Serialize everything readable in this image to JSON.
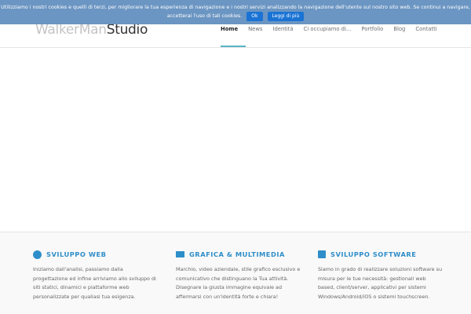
{
  "cookie_bar": {
    "text": "Utilizziamo i nostri cookies e quelli di terzi, per migliorare la tua esperienza di navigazione e i nostri servizi analizzando la navigazione dell'utente sul nostro sito web. Se continui a navigare, accetterai l'uso di tali cookies.",
    "ok_label": "Ok",
    "more_label": "Leggi di più"
  },
  "logo": {
    "part1": "WalkerMan",
    "part2": "Studio"
  },
  "nav": [
    "Home",
    "News",
    "Identità",
    "Ci occupiamo di...",
    "Portfolio",
    "Blog",
    "Contatti"
  ],
  "features": [
    {
      "icon": "globe-icon",
      "title": "SVILUPPO WEB",
      "text": "Iniziamo dall'analisi, passiamo dalla progettazione ed infine arriviamo allo sviluppo di siti statici, dinamici e piattaforme web personalizzate per qualiasi tua esigenza."
    },
    {
      "icon": "film-icon",
      "title": "GRAFICA & MULTIMEDIA",
      "text": "Marchio, video aziendale, stile grafico esclusivo e comunicativo che distinguano la Tua attività. Disegnare la giusta immagine equivale ad affermarsi con un'identità forte e chiara!"
    },
    {
      "icon": "floppy-disk-icon",
      "title": "SVILUPPO SOFTWARE",
      "text": "Siamo in grado di realizzare soluzioni software su misura per le tue necessità: gestionali web based, client/server, applicativi per sistemi Windows/Android/iOS o sistemi touchscreen."
    }
  ],
  "colors": {
    "accent": "#2e8ec9",
    "cookie_bg": "#6b95c2",
    "nav_underline": "#5bb5c8"
  }
}
